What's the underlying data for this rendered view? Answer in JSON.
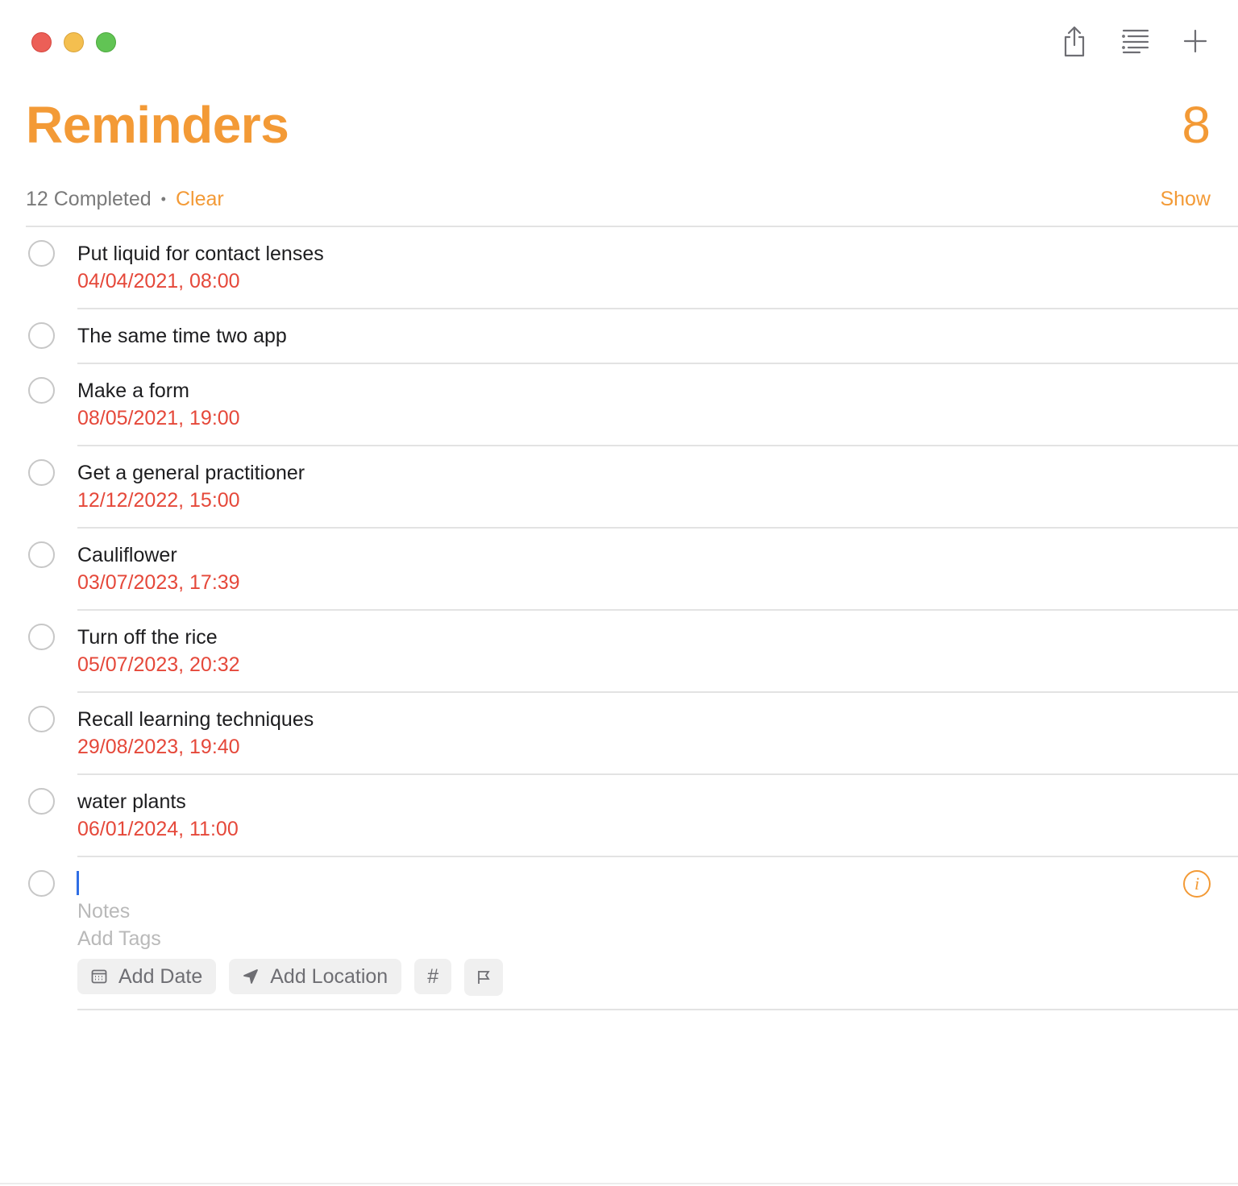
{
  "window": {
    "controls": [
      "close",
      "minimize",
      "zoom"
    ]
  },
  "toolbar": {
    "icons": [
      "share-icon",
      "list-view-icon",
      "add-icon"
    ]
  },
  "header": {
    "title": "Reminders",
    "count": "8"
  },
  "completed": {
    "text": "12 Completed",
    "separator": "•",
    "clear_label": "Clear",
    "show_label": "Show"
  },
  "reminders": [
    {
      "title": "Put liquid for contact lenses",
      "date": "04/04/2021, 08:00"
    },
    {
      "title": "The same time two app",
      "date": ""
    },
    {
      "title": "Make a form",
      "date": "08/05/2021, 19:00"
    },
    {
      "title": "Get a general practitioner",
      "date": "12/12/2022, 15:00"
    },
    {
      "title": "Cauliflower",
      "date": "03/07/2023, 17:39"
    },
    {
      "title": "Turn off the rice",
      "date": "05/07/2023, 20:32"
    },
    {
      "title": "Recall learning techniques",
      "date": "29/08/2023, 19:40"
    },
    {
      "title": "water plants",
      "date": "06/01/2024, 11:00"
    }
  ],
  "new_reminder": {
    "title_value": "",
    "notes_placeholder": "Notes",
    "tags_placeholder": "Add Tags",
    "add_date_label": "Add Date",
    "add_location_label": "Add Location",
    "tag_symbol": "#",
    "info_symbol": "i"
  },
  "colors": {
    "accent": "#f39a36",
    "date_red": "#e5483a",
    "caret_blue": "#2f6ee5"
  }
}
